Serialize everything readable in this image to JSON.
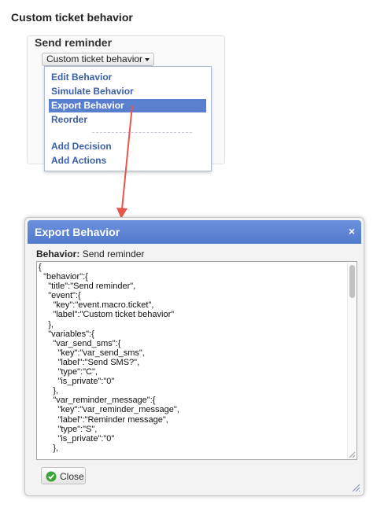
{
  "page": {
    "title": "Custom ticket behavior"
  },
  "behavior": {
    "name": "Send reminder",
    "menu_button_label": "Custom ticket behavior",
    "dropdown": {
      "items": [
        {
          "label": "Edit Behavior",
          "selected": false
        },
        {
          "label": "Simulate Behavior",
          "selected": false
        },
        {
          "label": "Export Behavior",
          "selected": true
        },
        {
          "label": "Reorder",
          "selected": false
        },
        {
          "label": "Add Decision",
          "selected": false
        },
        {
          "label": "Add Actions",
          "selected": false
        }
      ]
    }
  },
  "dialog": {
    "title": "Export Behavior",
    "close_glyph": "×",
    "behavior_label": "Behavior:",
    "behavior_value": "Send reminder",
    "json_lines": [
      "{",
      "  \"behavior\":{",
      "    \"title\":\"Send reminder\",",
      "    \"event\":{",
      "      \"key\":\"event.macro.ticket\",",
      "      \"label\":\"Custom ticket behavior\"",
      "    },",
      "    \"variables\":{",
      "      \"var_send_sms\":{",
      "        \"key\":\"var_send_sms\",",
      "        \"label\":\"Send SMS?\",",
      "        \"type\":\"C\",",
      "        \"is_private\":\"0\"",
      "      },",
      "      \"var_reminder_message\":{",
      "        \"key\":\"var_reminder_message\",",
      "        \"label\":\"Reminder message\",",
      "        \"type\":\"S\",",
      "        \"is_private\":\"0\"",
      "      },"
    ],
    "close_button_label": "Close"
  },
  "colors": {
    "header_blue": "#5b7fcf",
    "link_blue": "#3b5fa8",
    "arrow_red": "#e8564b",
    "success_green": "#3aa536"
  },
  "icons": {
    "close": "close-icon",
    "check": "check-circle-icon",
    "caret": "caret-down-icon",
    "grip": "resize-grip-icon"
  }
}
